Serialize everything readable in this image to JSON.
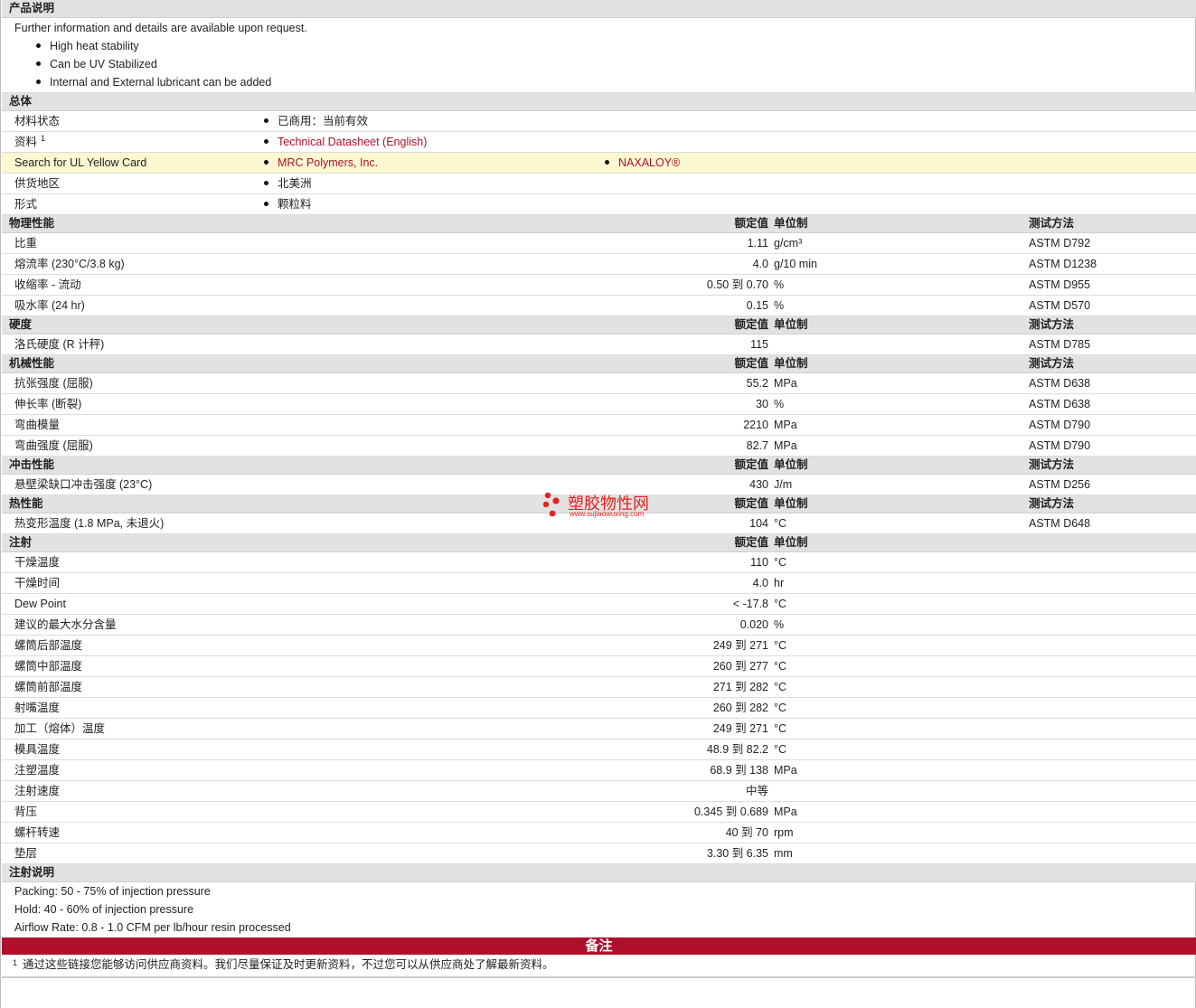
{
  "description": {
    "title": "产品说明",
    "intro": "Further information and details are available upon request.",
    "bullets": [
      "High heat stability",
      "Can be UV Stabilized",
      "Internal and External lubricant can be added"
    ]
  },
  "general": {
    "title": "总体",
    "rows": [
      {
        "label": "材料状态",
        "b1": "已商用：当前有效"
      },
      {
        "label": "资料",
        "sup": "1",
        "b1": "Technical Datasheet (English)"
      },
      {
        "label": "Search for UL Yellow Card",
        "b1": "MRC Polymers, Inc.",
        "b2": "NAXALOY®"
      },
      {
        "label": "供货地区",
        "b1": "北美洲"
      },
      {
        "label": "形式",
        "b1": "颗粒料"
      }
    ]
  },
  "headers": {
    "value": "额定值",
    "unit": "单位制",
    "method": "测试方法"
  },
  "physical": {
    "title": "物理性能",
    "rows": [
      {
        "label": "比重",
        "value": "1.11",
        "unit": "g/cm³",
        "method": "ASTM D792"
      },
      {
        "label": "熔流率  (230°C/3.8 kg)",
        "value": "4.0",
        "unit": "g/10 min",
        "method": "ASTM D1238"
      },
      {
        "label": "收缩率  - 流动",
        "value": "0.50 到  0.70",
        "unit": "%",
        "method": "ASTM D955"
      },
      {
        "label": "吸水率  (24 hr)",
        "value": "0.15",
        "unit": "%",
        "method": "ASTM D570"
      }
    ]
  },
  "hardness": {
    "title": "硬度",
    "rows": [
      {
        "label": "洛氏硬度  (R 计秤)",
        "value": "115",
        "unit": "",
        "method": "ASTM D785"
      }
    ]
  },
  "mechanical": {
    "title": "机械性能",
    "rows": [
      {
        "label": "抗张强度  (屈服)",
        "value": "55.2",
        "unit": "MPa",
        "method": "ASTM D638"
      },
      {
        "label": "伸长率  (断裂)",
        "value": "30",
        "unit": "%",
        "method": "ASTM D638"
      },
      {
        "label": "弯曲模量",
        "value": "2210",
        "unit": "MPa",
        "method": "ASTM D790"
      },
      {
        "label": "弯曲强度  (屈服)",
        "value": "82.7",
        "unit": "MPa",
        "method": "ASTM D790"
      }
    ]
  },
  "impact": {
    "title": "冲击性能",
    "rows": [
      {
        "label": "悬壁梁缺口冲击强度  (23°C)",
        "value": "430",
        "unit": "J/m",
        "method": "ASTM D256"
      }
    ]
  },
  "thermal": {
    "title": "热性能",
    "rows": [
      {
        "label": "热变形温度  (1.8 MPa, 未退火)",
        "value": "104",
        "unit": "°C",
        "method": "ASTM D648"
      }
    ]
  },
  "injection": {
    "title": "注射",
    "rows": [
      {
        "label": "干燥温度",
        "value": "110",
        "unit": "°C"
      },
      {
        "label": "干燥时间",
        "value": "4.0",
        "unit": "hr"
      },
      {
        "label": "Dew Point",
        "value": "< -17.8",
        "unit": "°C"
      },
      {
        "label": "建议的最大水分含量",
        "value": "0.020",
        "unit": "%"
      },
      {
        "label": "螺筒后部温度",
        "value": "249 到  271",
        "unit": "°C"
      },
      {
        "label": "螺筒中部温度",
        "value": "260 到  277",
        "unit": "°C"
      },
      {
        "label": "螺筒前部温度",
        "value": "271 到  282",
        "unit": "°C"
      },
      {
        "label": "射嘴温度",
        "value": "260 到  282",
        "unit": "°C"
      },
      {
        "label": "加工（熔体）温度",
        "value": "249 到  271",
        "unit": "°C"
      },
      {
        "label": "模具温度",
        "value": "48.9 到  82.2",
        "unit": "°C"
      },
      {
        "label": "注塑温度",
        "value": "68.9 到  138",
        "unit": "MPa"
      },
      {
        "label": "注射速度",
        "value": "中等",
        "unit": ""
      },
      {
        "label": "背压",
        "value": "0.345 到  0.689",
        "unit": "MPa"
      },
      {
        "label": "螺杆转速",
        "value": "40 到  70",
        "unit": "rpm"
      },
      {
        "label": "垫层",
        "value": "3.30 到  6.35",
        "unit": "mm"
      }
    ]
  },
  "injection_notes": {
    "title": "注射说明",
    "lines": [
      "Packing: 50 - 75% of injection pressure",
      "Hold: 40 - 60% of injection pressure",
      "Airflow Rate: 0.8 - 1.0 CFM per lb/hour resin processed"
    ]
  },
  "remarks": {
    "title": "备注",
    "footnote_mark": "1",
    "footnote": "通过这些链接您能够访问供应商资料。我们尽量保证及时更新资料，不过您可以从供应商处了解最新资料。"
  },
  "watermark": {
    "name": "塑胶物性网",
    "url": "www.sujiaowuxing.com"
  },
  "colors": {
    "link": "#b0102c",
    "banner": "#b0102c",
    "section_bg": "#e2e2e2",
    "highlight_row": "#fdf8d2"
  }
}
